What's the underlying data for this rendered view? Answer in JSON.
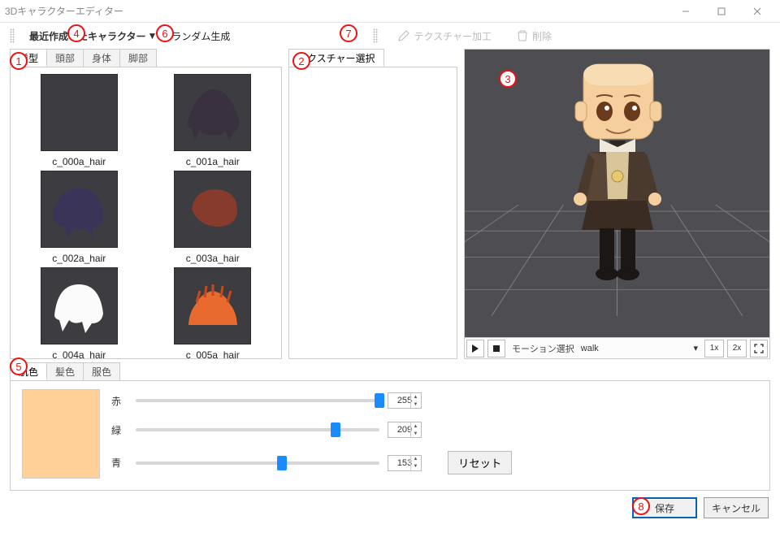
{
  "window": {
    "title": "3Dキャラクターエディター"
  },
  "toolbar": {
    "recent_label": "最近作成したキャラクター",
    "random_label": "ランダム生成",
    "texture_tool_label": "テクスチャー加工",
    "delete_label": "削除"
  },
  "parts_tabs": {
    "hair": "髪型",
    "head": "頭部",
    "body": "身体",
    "legs": "脚部"
  },
  "hair_items": [
    {
      "name": "c_000a_hair",
      "style": "blank"
    },
    {
      "name": "c_001a_hair",
      "style": "h0"
    },
    {
      "name": "c_002a_hair",
      "style": "h0"
    },
    {
      "name": "c_003a_hair",
      "style": "h1"
    },
    {
      "name": "c_004a_hair",
      "style": "h2"
    },
    {
      "name": "c_005a_hair",
      "style": "h3"
    }
  ],
  "texture_tab": {
    "label": "テクスチャー選択"
  },
  "motion": {
    "label": "モーション選択",
    "selected": "walk",
    "speed1": "1x",
    "speed2": "2x"
  },
  "color_tabs": {
    "skin": "肌色",
    "hair": "髪色",
    "clothes": "服色"
  },
  "color": {
    "red_label": "赤",
    "green_label": "緑",
    "blue_label": "青",
    "red": 255,
    "green": 209,
    "blue": 153,
    "reset_label": "リセット",
    "preview_hex": "#ffd199"
  },
  "footer": {
    "save": "保存",
    "cancel": "キャンセル"
  },
  "annotations": {
    "n1": "1",
    "n2": "2",
    "n3": "3",
    "n4": "4",
    "n5": "5",
    "n6": "6",
    "n7": "7",
    "n8": "8"
  }
}
